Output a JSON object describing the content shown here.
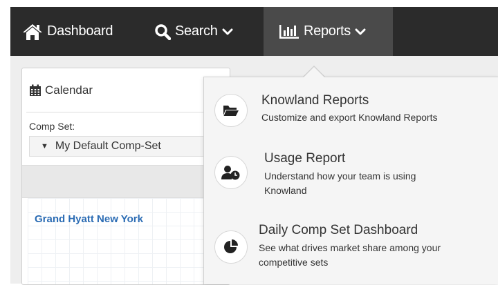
{
  "navbar": {
    "dashboard_label": "Dashboard",
    "search_label": "Search",
    "reports_label": "Reports"
  },
  "calendar": {
    "title": "Calendar",
    "comp_set_label": "Comp Set:",
    "comp_set_value": "My Default Comp-Set",
    "hotel_name": "Grand Hyatt New York"
  },
  "reports_menu": {
    "items": [
      {
        "title": "Knowland Reports",
        "description": "Customize and export Knowland Reports",
        "icon": "folder-open-icon"
      },
      {
        "title": "Usage Report",
        "description": "Understand how your team is using Knowland",
        "icon": "user-clock-icon"
      },
      {
        "title": "Daily Comp Set Dashboard",
        "description": "See what drives market share among your competitive sets",
        "icon": "pie-chart-icon"
      }
    ]
  },
  "colors": {
    "navbar_bg": "#2b2b2b",
    "navbar_active_bg": "#4a4a4a",
    "link_blue": "#2b6cb4",
    "dropdown_bg": "#f5f5f5"
  }
}
